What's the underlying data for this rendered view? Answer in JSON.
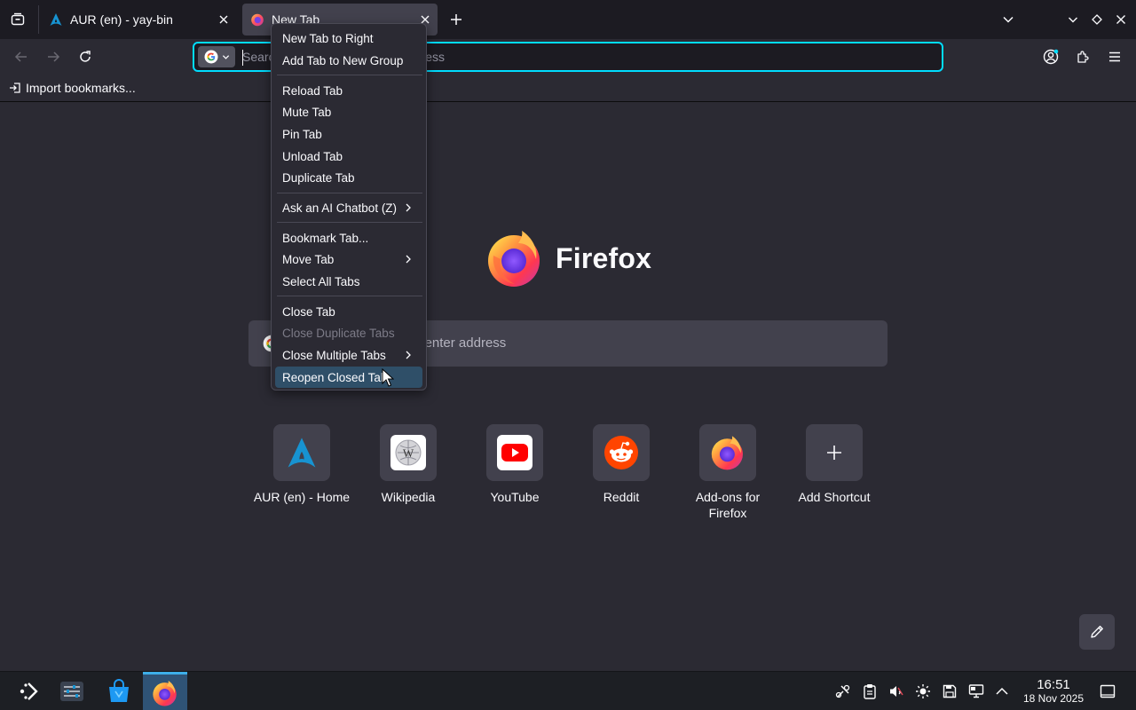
{
  "tabs": [
    {
      "title": "AUR (en) - yay-bin",
      "icon": "arch-linux-icon"
    },
    {
      "title": "New Tab",
      "icon": "firefox-icon",
      "active": true
    }
  ],
  "urlbar": {
    "placeholder": "Search with Google or enter address",
    "engine": "google-icon"
  },
  "bookmarks": {
    "import_label": "Import bookmarks..."
  },
  "newtab": {
    "wordmark": "Firefox",
    "search_placeholder": "Search with Google or enter address",
    "shortcuts": [
      {
        "label": "AUR (en) - Home",
        "icon": "arch-linux-icon"
      },
      {
        "label": "Wikipedia",
        "icon": "wikipedia-icon"
      },
      {
        "label": "YouTube",
        "icon": "youtube-icon"
      },
      {
        "label": "Reddit",
        "icon": "reddit-icon"
      },
      {
        "label": "Add-ons for Firefox",
        "icon": "firefox-icon"
      },
      {
        "label": "Add Shortcut",
        "icon": "plus-icon"
      }
    ]
  },
  "context_menu": {
    "items": [
      {
        "label": "New Tab to Right"
      },
      {
        "label": "Add Tab to New Group"
      },
      {
        "label": "Reload Tab"
      },
      {
        "label": "Mute Tab"
      },
      {
        "label": "Pin Tab"
      },
      {
        "label": "Unload Tab"
      },
      {
        "label": "Duplicate Tab"
      },
      {
        "label": "Ask an AI Chatbot (Z)",
        "submenu": true
      },
      {
        "label": "Bookmark Tab..."
      },
      {
        "label": "Move Tab",
        "submenu": true
      },
      {
        "label": "Select All Tabs"
      },
      {
        "label": "Close Tab"
      },
      {
        "label": "Close Duplicate Tabs",
        "disabled": true
      },
      {
        "label": "Close Multiple Tabs",
        "submenu": true
      },
      {
        "label": "Reopen Closed Tab",
        "highlighted": true
      }
    ]
  },
  "taskbar": {
    "time": "16:51",
    "date": "18 Nov 2025"
  },
  "colors": {
    "accent": "#00ddff",
    "menu_highlight": "#2f4f68",
    "taskbar_active": "#2f5376"
  }
}
